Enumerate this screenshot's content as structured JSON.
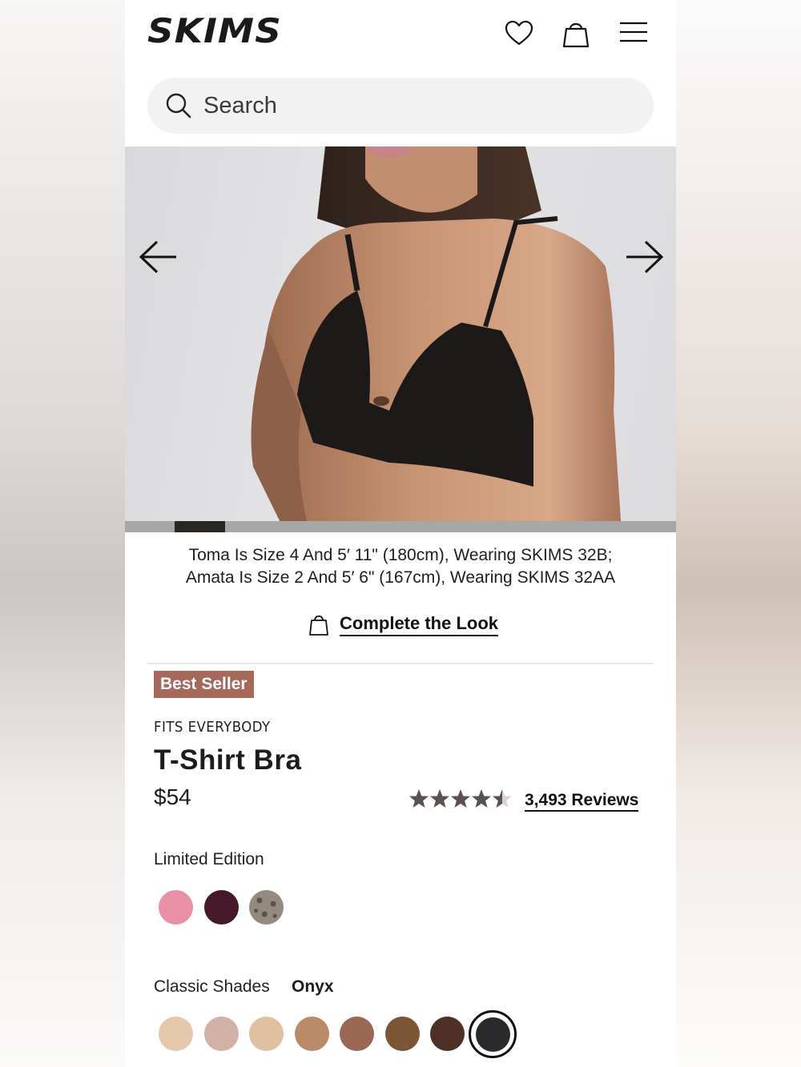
{
  "brand": {
    "logo_text": "SKIMS"
  },
  "header": {
    "icons": [
      "heart-icon",
      "shopping-bag-icon",
      "menu-icon"
    ]
  },
  "search": {
    "placeholder": "Search"
  },
  "gallery": {
    "progress_fraction": 0.09,
    "progress_position_fraction": 0.09
  },
  "caption": {
    "line1": "Toma Is Size 4 And 5′ 11\" (180cm), Wearing SKIMS 32B;",
    "line2": "Amata Is Size 2 And 5′ 6\" (167cm), Wearing SKIMS 32AA"
  },
  "complete_look": {
    "label": "Complete the Look"
  },
  "product": {
    "badge": "Best Seller",
    "eyebrow": "FITS EVERYBODY",
    "title": "T-Shirt Bra",
    "price": "$54",
    "rating": 4.5,
    "reviews_label": "3,493 Reviews"
  },
  "colors": {
    "limited_label": "Limited Edition",
    "limited_swatches": [
      "#ea90a6",
      "#45182a",
      "leopard"
    ],
    "classic_label": "Classic Shades",
    "classic_selected": "Onyx",
    "classic_swatches": [
      "#e4c8a9",
      "#d1b1a5",
      "#dfc0a0",
      "#ba8a69",
      "#9a6755",
      "#7a5634",
      "#4e3026",
      "#2a2a2c"
    ],
    "selected_index": 7
  },
  "accent_colors": {
    "badge": "#a5685a",
    "star": "#5a5250"
  }
}
